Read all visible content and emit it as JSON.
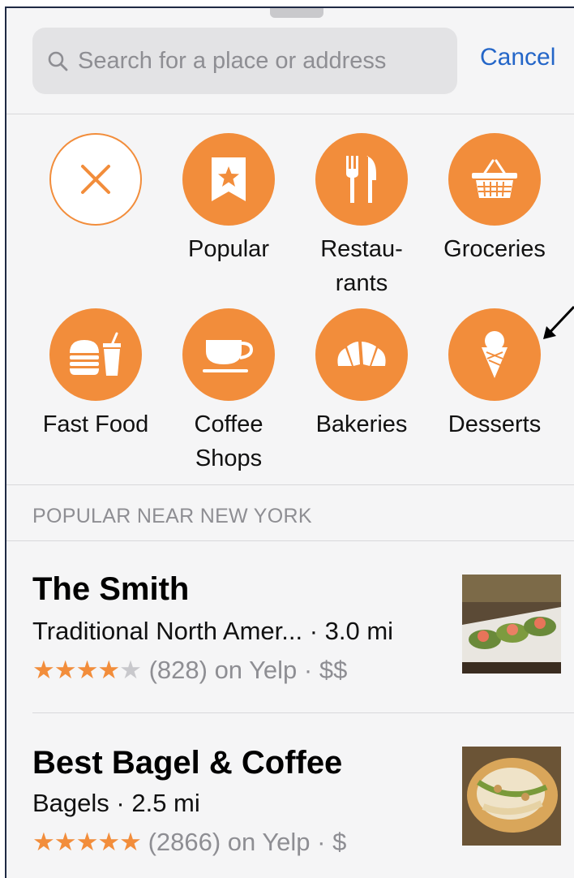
{
  "search": {
    "placeholder": "Search for a place or address",
    "cancel_label": "Cancel"
  },
  "categories": [
    {
      "label": "",
      "icon": "close-icon"
    },
    {
      "label": "Popular",
      "icon": "bookmark-star-icon"
    },
    {
      "label": "Restau-\nrants",
      "icon": "fork-knife-icon"
    },
    {
      "label": "Groceries",
      "icon": "basket-icon"
    },
    {
      "label": "Fast Food",
      "icon": "burger-drink-icon"
    },
    {
      "label": "Coffee\nShops",
      "icon": "coffee-cup-icon"
    },
    {
      "label": "Bakeries",
      "icon": "croissant-icon"
    },
    {
      "label": "Desserts",
      "icon": "ice-cream-icon"
    }
  ],
  "section": {
    "heading": "POPULAR NEAR NEW YORK"
  },
  "places": [
    {
      "name": "The Smith",
      "subtitle": "Traditional North Amer... · 3.0 mi",
      "stars_on": "★★★★",
      "stars_off": "★",
      "rating": 4,
      "rating_text": " (828) on Yelp · $$"
    },
    {
      "name": "Best Bagel & Coffee",
      "subtitle": "Bagels · 2.5 mi",
      "stars_on": "★★★★★",
      "stars_off": "",
      "rating": 4.5,
      "rating_text": " (2866) on Yelp · $"
    }
  ],
  "colors": {
    "accent": "#f28d3b",
    "link": "#2466c8",
    "muted": "#8e8e93"
  }
}
